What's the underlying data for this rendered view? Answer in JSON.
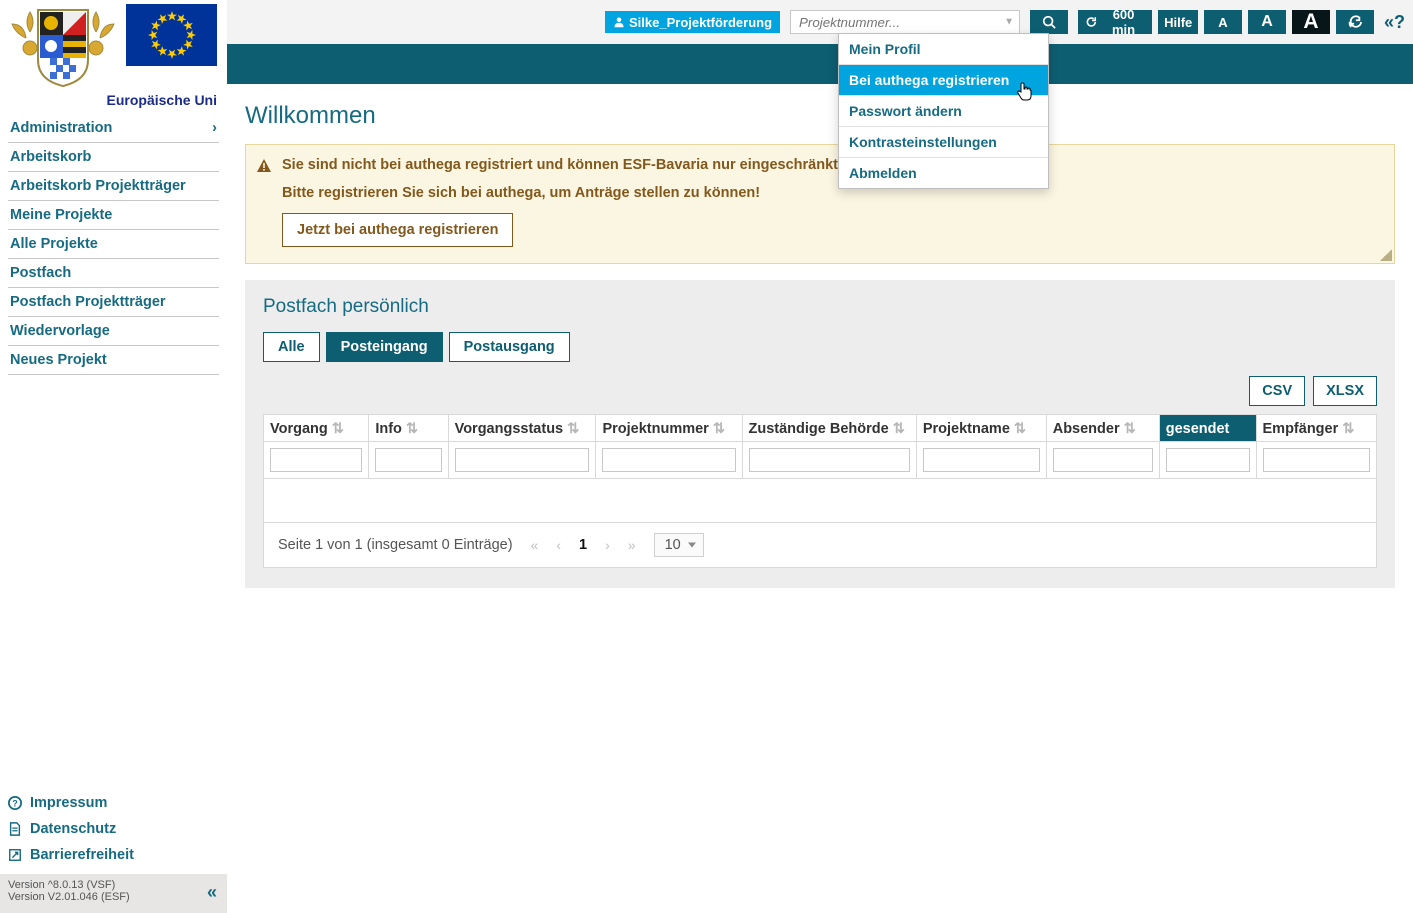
{
  "eu_label": "Europäische Uni",
  "sidebar": {
    "items": [
      {
        "label": "Administration",
        "chev": true
      },
      {
        "label": "Arbeitskorb"
      },
      {
        "label": "Arbeitskorb Projektträger"
      },
      {
        "label": "Meine Projekte"
      },
      {
        "label": "Alle Projekte"
      },
      {
        "label": "Postfach"
      },
      {
        "label": "Postfach Projektträger"
      },
      {
        "label": "Wiedervorlage"
      },
      {
        "label": "Neues Projekt"
      }
    ],
    "footer": {
      "impressum": "Impressum",
      "datenschutz": "Datenschutz",
      "barrierefreiheit": "Barrierefreiheit"
    },
    "version1": "Version ^8.0.13 (VSF)",
    "version2": "Version V2.01.046 (ESF)"
  },
  "topbar": {
    "user": "Silke_Projektförderung",
    "search_placeholder": "Projektnummer...",
    "session": "600 min",
    "help": "Hilfe"
  },
  "dropdown": {
    "items": [
      "Mein Profil",
      "Bei authega registrieren",
      "Passwort ändern",
      "Kontrasteinstellungen",
      "Abmelden"
    ],
    "hover_index": 1
  },
  "page": {
    "title": "Willkommen"
  },
  "warning": {
    "line1": "Sie sind nicht bei authega registriert und können ESF-Bavaria nur eingeschränkt nutzen!",
    "line2": "Bitte registrieren Sie sich bei authega, um Anträge stellen zu können!",
    "button": "Jetzt bei authega registrieren"
  },
  "panel": {
    "title": "Postfach persönlich",
    "tabs": [
      "Alle",
      "Posteingang",
      "Postausgang"
    ],
    "active_tab": 1,
    "exports": {
      "csv": "CSV",
      "xlsx": "XLSX"
    },
    "columns": [
      "Vorgang",
      "Info",
      "Vorgangsstatus",
      "Projektnummer",
      "Zuständige Behörde",
      "Projektname",
      "Absender",
      "gesendet",
      "Empfänger"
    ],
    "sorted_col": "gesendet",
    "pager": {
      "summary": "Seite 1 von 1 (insgesamt 0 Einträge)",
      "current": "1",
      "size": "10"
    }
  }
}
